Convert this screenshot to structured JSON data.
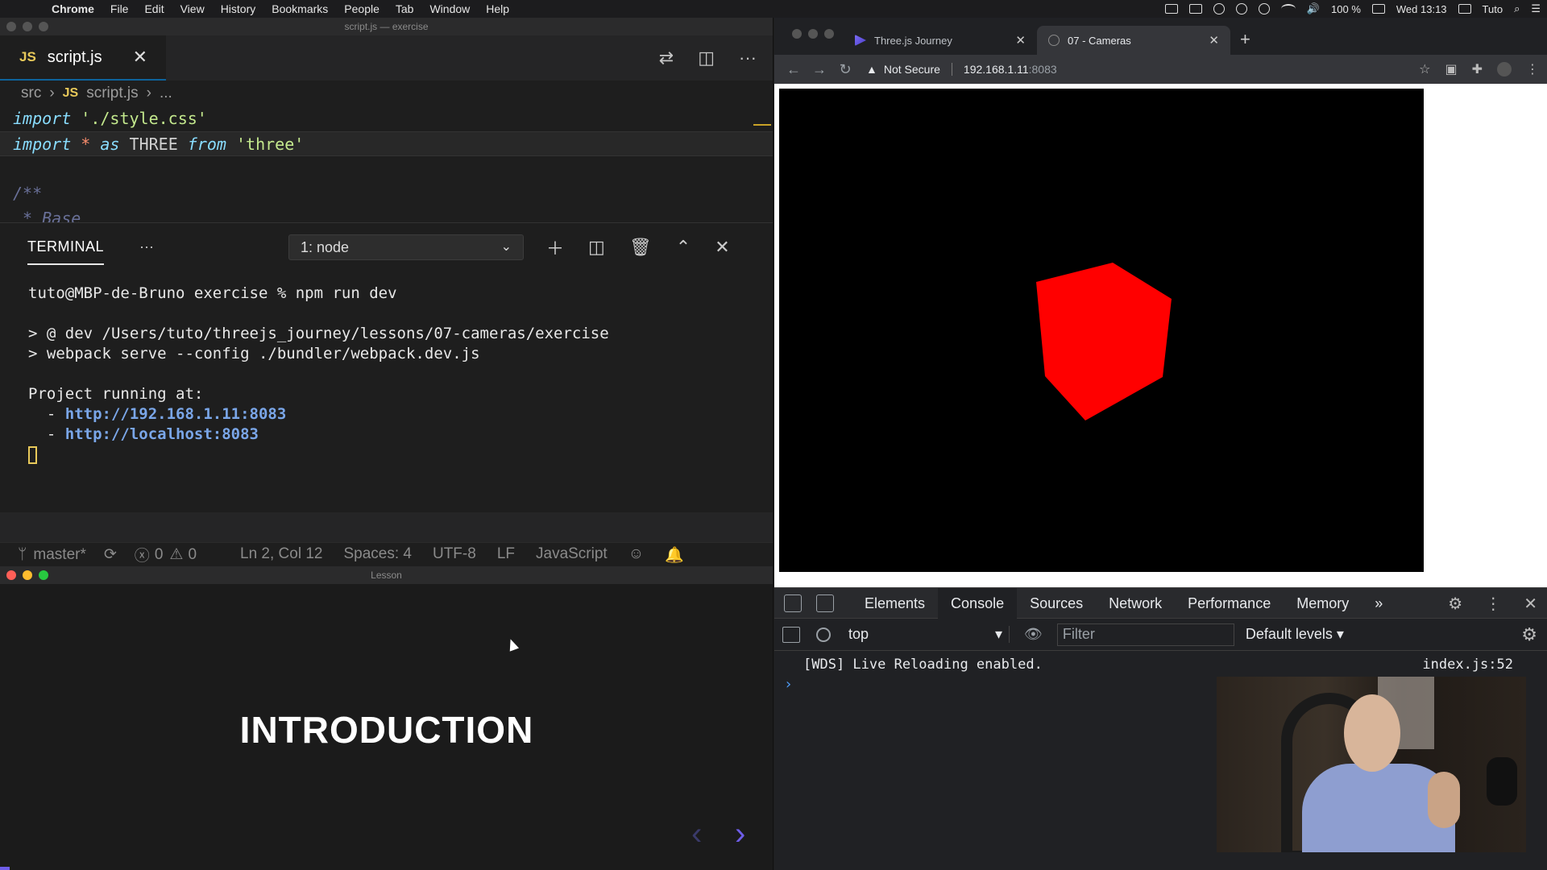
{
  "menubar": {
    "app": "Chrome",
    "items": [
      "File",
      "Edit",
      "View",
      "History",
      "Bookmarks",
      "People",
      "Tab",
      "Window",
      "Help"
    ],
    "battery": "100 %",
    "clock": "Wed 13:13",
    "user": "Tuto"
  },
  "vscode": {
    "window_title": "script.js — exercise",
    "tab": {
      "lang": "JS",
      "name": "script.js"
    },
    "breadcrumb": {
      "folder": "src",
      "lang": "JS",
      "file": "script.js",
      "more": "..."
    },
    "code": [
      {
        "kw": "import",
        "str": "'./style.css'"
      },
      {
        "kw1": "import",
        "star": "*",
        "kw2": "as",
        "ident": "THREE",
        "kw3": "from",
        "str": "'three'"
      }
    ],
    "comment_lines": [
      "/**",
      " * Base",
      " */"
    ],
    "terminal": {
      "title": "TERMINAL",
      "more": "···",
      "select_value": "1: node",
      "lines": {
        "prompt": "tuto@MBP-de-Bruno exercise % npm run dev",
        "script1": "> @ dev /Users/tuto/threejs_journey/lessons/07-cameras/exercise",
        "script2": "> webpack serve --config ./bundler/webpack.dev.js",
        "running": "Project running at:",
        "dash": "  - ",
        "link1": "http://192.168.1.11:8083",
        "link2": "http://localhost:8083"
      }
    },
    "statusbar": {
      "branch": "master*",
      "errors": "0",
      "warnings": "0",
      "position": "Ln 2, Col 12",
      "spaces": "Spaces: 4",
      "encoding": "UTF-8",
      "eol": "LF",
      "language": "JavaScript"
    }
  },
  "lesson": {
    "window_title": "Lesson",
    "heading": "INTRODUCTION",
    "prev": "‹",
    "next": "›"
  },
  "chrome": {
    "tabs": [
      {
        "title": "Three.js Journey",
        "active": false
      },
      {
        "title": "07 - Cameras",
        "active": true
      }
    ],
    "security": "Not Secure",
    "url_host": "192.168.1.11",
    "url_port": ":8083",
    "scene": {
      "background": "#000000",
      "cube_color": "#ff0000"
    },
    "devtools": {
      "tabs": [
        "Elements",
        "Console",
        "Sources",
        "Network",
        "Performance",
        "Memory"
      ],
      "active_tab": "Console",
      "context": "top",
      "filter_placeholder": "Filter",
      "levels": "Default levels",
      "log": {
        "message": "[WDS] Live Reloading enabled.",
        "source": "index.js:52"
      },
      "prompt": "›"
    }
  },
  "colors": {
    "accent_purple": "#6e5de8",
    "link_blue": "#7aa6e8",
    "js_yellow": "#e8c95a"
  }
}
